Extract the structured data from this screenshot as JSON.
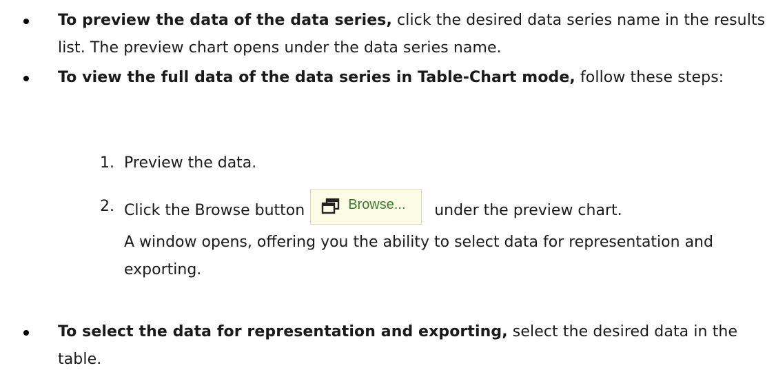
{
  "bullets": [
    {
      "bold": "To preview the data of the data series,",
      "text": " click the desired data series name in the results list. The preview chart opens under the data series name."
    },
    {
      "bold": "To view the full data of the data series in Table-Chart mode,",
      "text": " follow these steps:"
    },
    {
      "bold": "To select the data for representation and exporting,",
      "text": " select the desired data in the table."
    }
  ],
  "steps": [
    {
      "number": "1.",
      "text": "Preview the data."
    },
    {
      "number": "2.",
      "text_before": "Click the Browse button",
      "text_after": "under the preview chart.",
      "text_continued": "A window opens, offering you the ability to select data for representation and exporting."
    }
  ],
  "browse_button": {
    "label": "Browse...",
    "icon": "restore-window-icon",
    "label_color": "#3e7a2c",
    "background": "#fbfbe6"
  }
}
